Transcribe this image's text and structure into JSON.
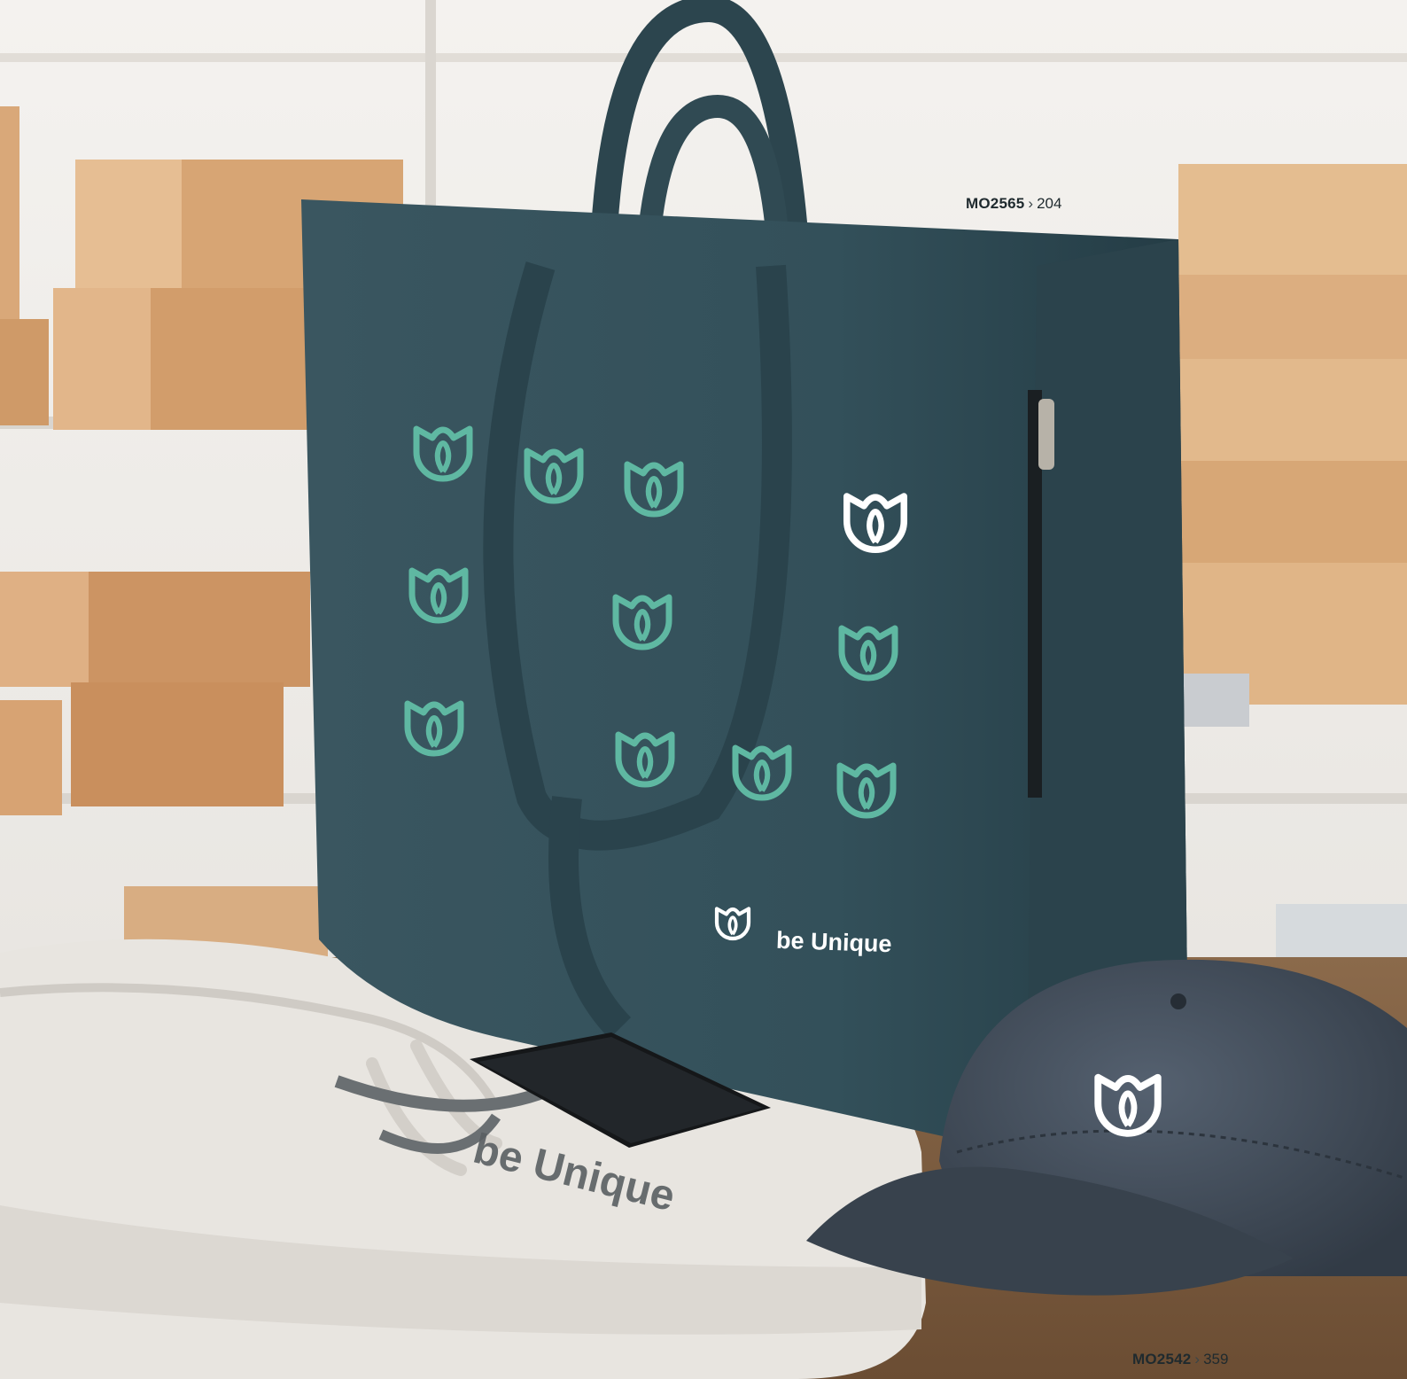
{
  "captions": {
    "bag": {
      "code": "MO2565",
      "separator": "›",
      "page": "204"
    },
    "cap": {
      "code": "MO2542",
      "separator": "›",
      "page": "359"
    }
  },
  "branding": {
    "bag_print": "be Unique",
    "hoodie_print": "be Unique"
  },
  "colors": {
    "bag": "#34505a",
    "bag_pattern": "#5fb8a2",
    "cap": "#3f4a56",
    "hoodie": "#e6e3de",
    "boxes": "#d4a373",
    "table": "#7a5a3e"
  },
  "icons": [
    "tulip-logo-icon"
  ]
}
